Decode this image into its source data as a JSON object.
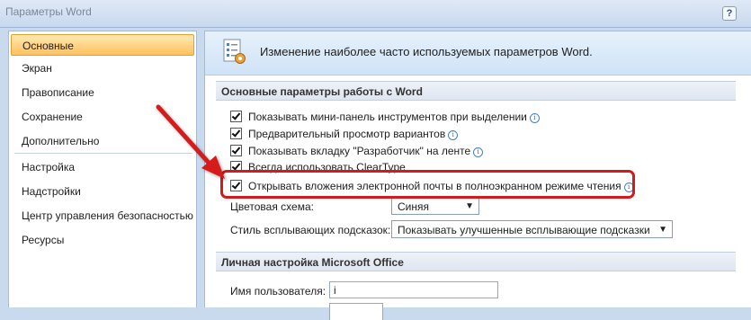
{
  "window": {
    "title": "Параметры Word",
    "help_glyph": "?"
  },
  "sidebar": {
    "items": [
      {
        "label": "Основные",
        "active": true
      },
      {
        "label": "Экран"
      },
      {
        "label": "Правописание"
      },
      {
        "label": "Сохранение"
      },
      {
        "label": "Дополнительно"
      },
      {
        "label": "Настройка"
      },
      {
        "label": "Надстройки"
      },
      {
        "label": "Центр управления безопасностью"
      },
      {
        "label": "Ресурсы"
      }
    ]
  },
  "main": {
    "banner": "Изменение наиболее часто используемых параметров Word.",
    "section1": {
      "title": "Основные параметры работы с Word",
      "options": [
        {
          "label": "Показывать мини-панель инструментов при выделении",
          "checked": true
        },
        {
          "label": "Предварительный просмотр вариантов",
          "checked": true
        },
        {
          "label": "Показывать вкладку \"Разработчик\" на ленте",
          "checked": true
        },
        {
          "label": "Всегда использовать ClearType",
          "checked": true
        },
        {
          "label": "Открывать вложения электронной почты в полноэкранном режиме чтения",
          "checked": true
        }
      ],
      "color_scheme": {
        "label": "Цветовая схема:",
        "value": "Синяя"
      },
      "tooltip_style": {
        "label": "Стиль всплывающих подсказок:",
        "value": "Показывать улучшенные всплывающие подсказки"
      }
    },
    "section2": {
      "title": "Личная настройка Microsoft Office",
      "username": {
        "label": "Имя пользователя:",
        "value": "i"
      }
    }
  },
  "annotation": {
    "highlight_color": "#d41a1a"
  },
  "icons": {
    "info": "info-icon",
    "checkbox": "checkmark"
  }
}
